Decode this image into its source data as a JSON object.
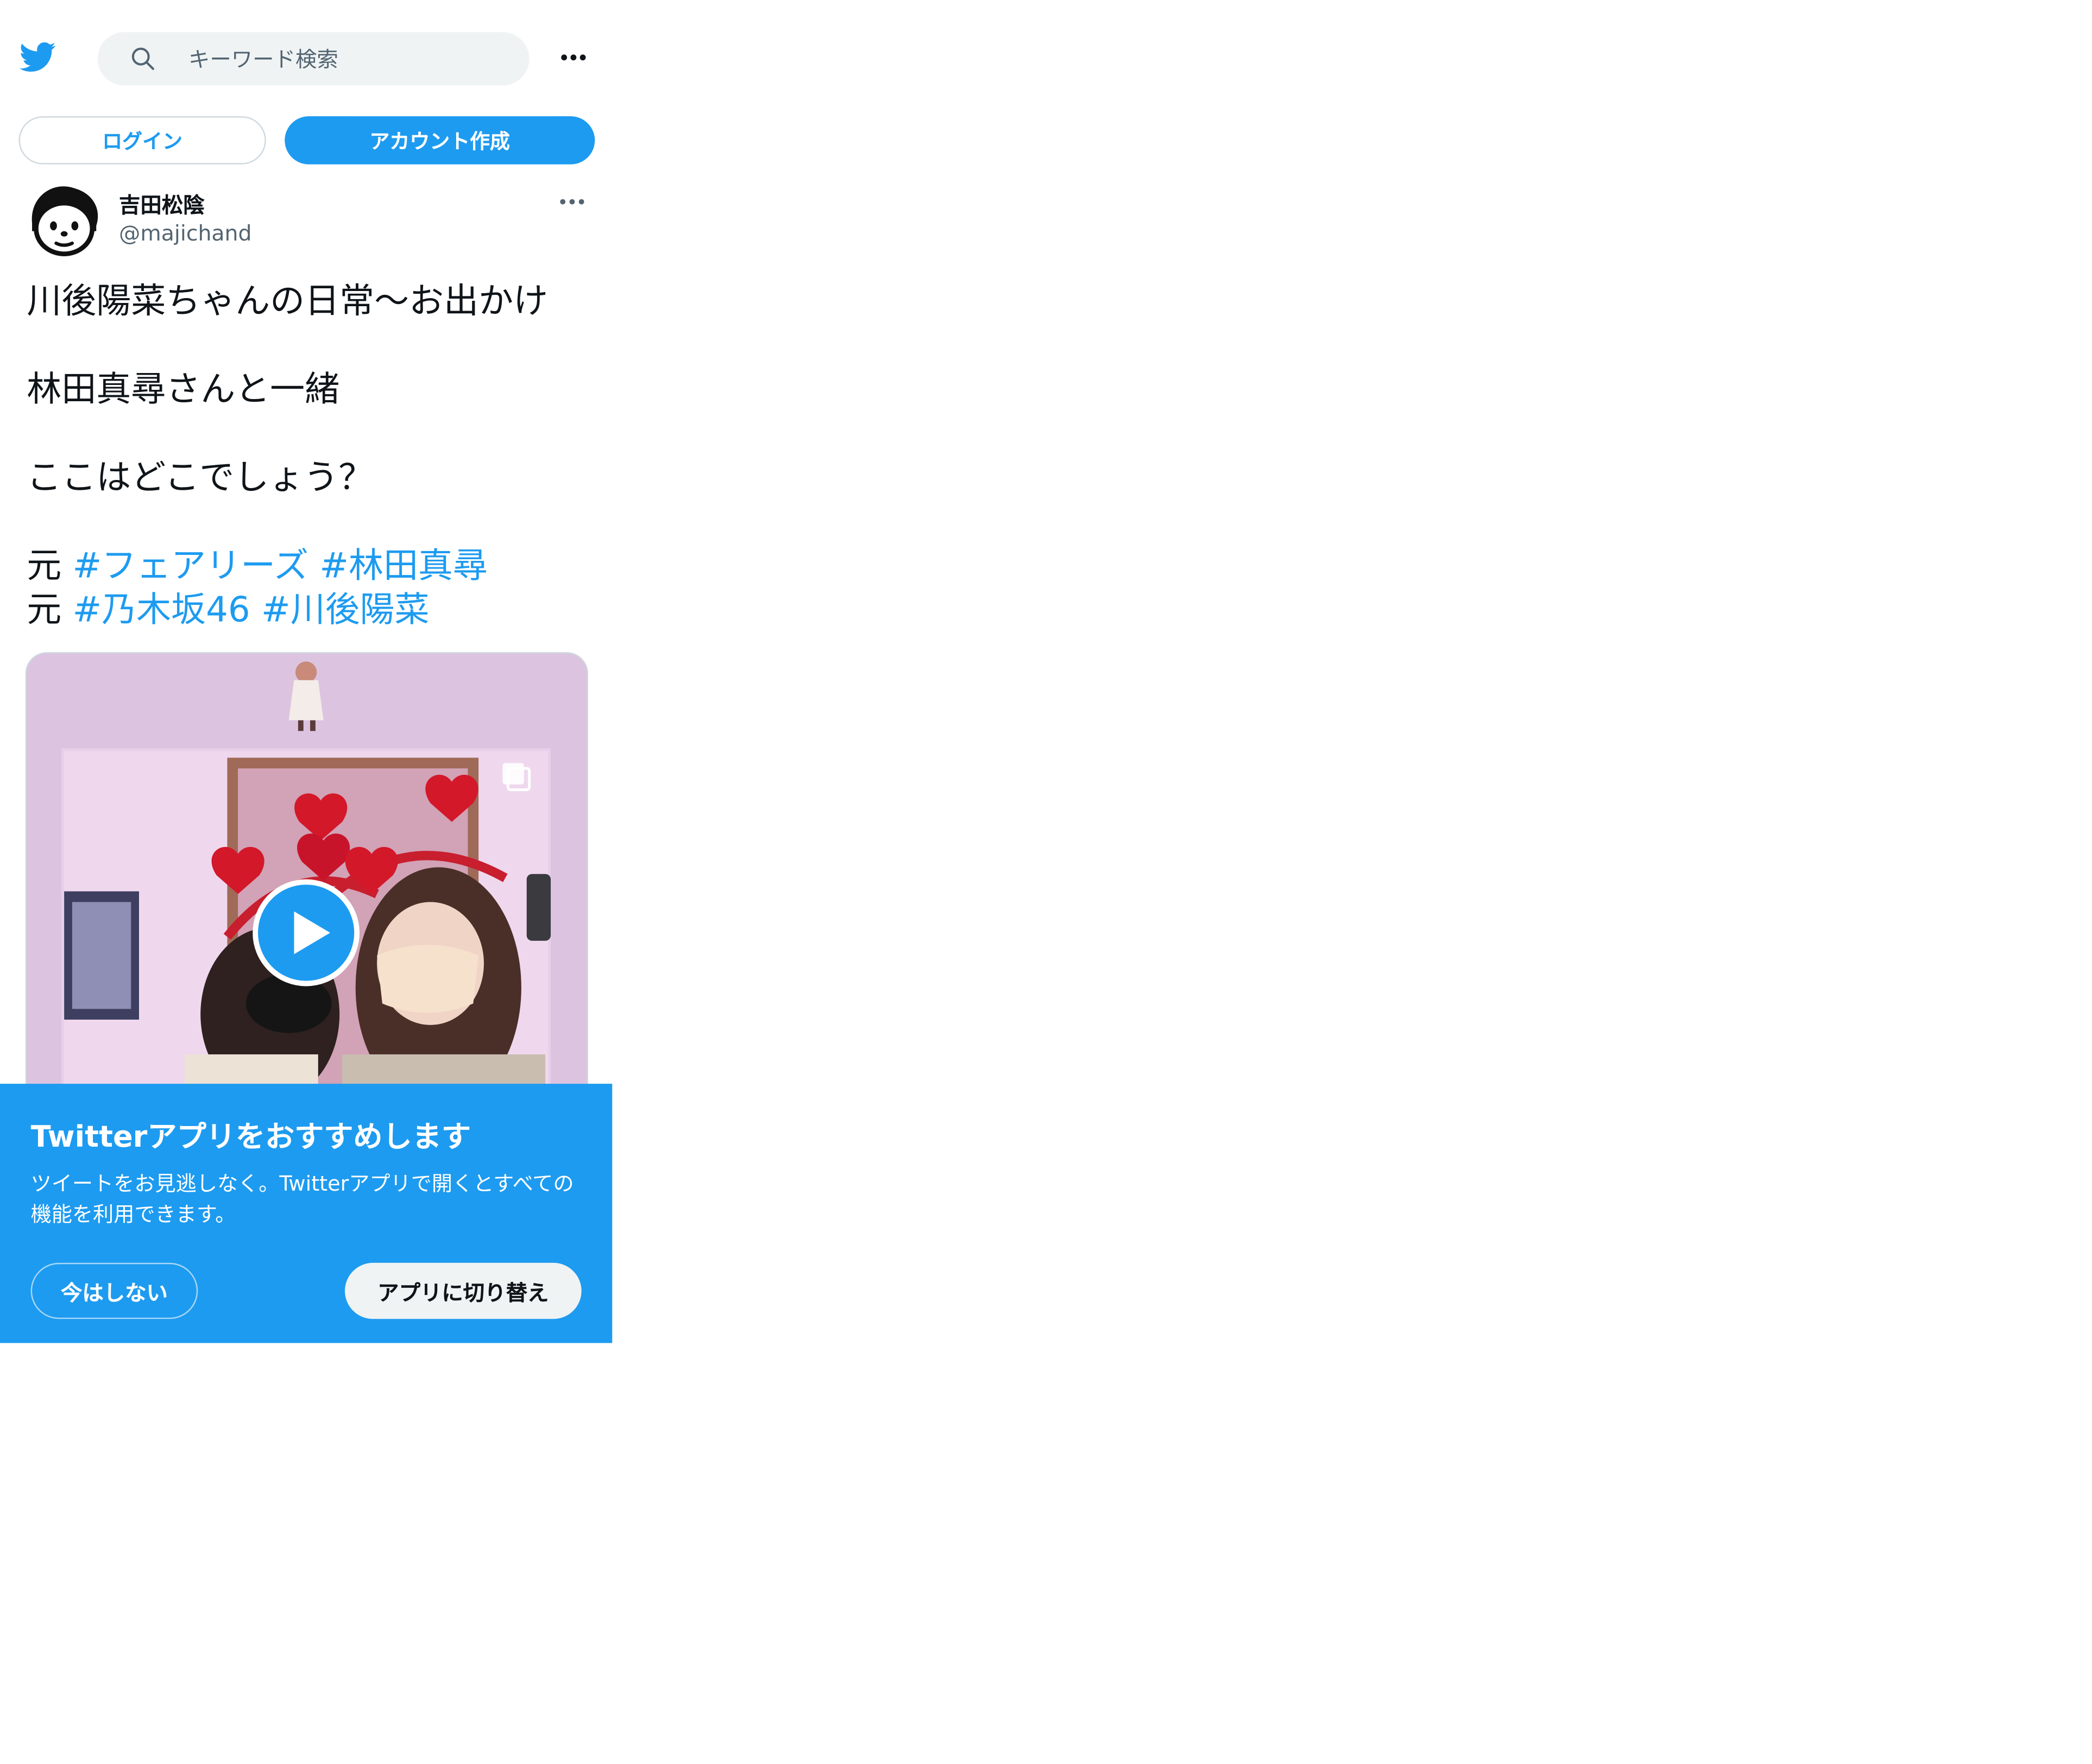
{
  "header": {
    "search_placeholder": "キーワード検索",
    "login_label": "ログイン",
    "signup_label": "アカウント作成"
  },
  "tweet": {
    "author_name": "吉田松陰",
    "author_handle": "@majichand",
    "text": {
      "line1": "川後陽菜ちゃんの日常～お出かけ",
      "line2": "林田真尋さんと一緒",
      "line3": "ここはどこでしょう？",
      "prefix1": "元 ",
      "hashtag1": "#フェアリーズ",
      "hashtag2": "#林田真尋",
      "prefix2": "元 ",
      "hashtag3": "#乃木坂46",
      "hashtag4": "#川後陽菜"
    },
    "media_type": "video"
  },
  "app_banner": {
    "title": "Twitterアプリをおすすめします",
    "body": "ツイートをお見逃しなく。Twitterアプリで開くとすべての機能を利用できます。",
    "not_now_label": "今はしない",
    "switch_label": "アプリに切り替え"
  },
  "colors": {
    "brand_blue": "#1d9bf0",
    "text_primary": "#0f1419",
    "text_secondary": "#536471",
    "search_bg": "#eff3f4"
  }
}
